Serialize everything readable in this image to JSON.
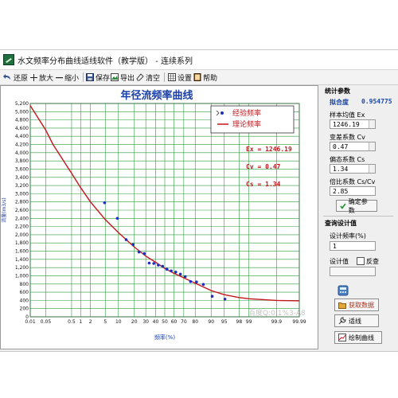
{
  "window": {
    "title": "水文频率分布曲线适线软件（教学版） - 连续系列"
  },
  "toolbar": {
    "restore": "还原",
    "zoom_in": "放大",
    "zoom_out": "缩小",
    "save": "保存",
    "export": "导出",
    "clear": "清空",
    "settings": "设置",
    "help": "帮助"
  },
  "colors": {
    "theory_curve": "#c4161c",
    "points": "#1f2fbf",
    "grid": "#2e9a3e",
    "title": "#1a3fa8",
    "stats_text": "#c4161c"
  },
  "chart": {
    "legend_empirical": "经验频率",
    "legend_theory": "理论频率",
    "stat_ex": "Ex = 1246.19",
    "stat_cv": "Cv = 0.47",
    "stat_cs": "Cs = 1.34"
  },
  "chart_data": {
    "type": "scatter",
    "title": "年径流频率曲线",
    "xlabel": "频率(%)",
    "ylabel": "流量(m3/s)",
    "ylim": [
      0,
      5200
    ],
    "yticks": [
      0,
      200,
      400,
      600,
      800,
      1000,
      1200,
      1400,
      1600,
      1800,
      2000,
      2200,
      2400,
      2600,
      2800,
      3000,
      3200,
      3400,
      3600,
      3800,
      4000,
      4200,
      4400,
      4600,
      4800,
      5000,
      5200
    ],
    "xticks": [
      0.01,
      0.05,
      0.5,
      1,
      2,
      5,
      10,
      20,
      30,
      40,
      50,
      60,
      70,
      80,
      90,
      95,
      98,
      99,
      99.9,
      99.99
    ],
    "x_scale": "probability",
    "grid": true,
    "legend_position": "top-right",
    "series": [
      {
        "name": "经验频率",
        "kind": "scatter",
        "x": [
          4.8,
          9.5,
          14.3,
          19.0,
          23.8,
          28.6,
          33.3,
          38.1,
          42.9,
          47.6,
          52.4,
          57.1,
          61.9,
          66.7,
          71.4,
          76.2,
          81.0,
          85.7,
          90.5,
          95.2
        ],
        "y": [
          2780,
          2400,
          1880,
          1760,
          1580,
          1540,
          1310,
          1300,
          1260,
          1230,
          1160,
          1120,
          1090,
          1040,
          980,
          860,
          850,
          790,
          500,
          430
        ]
      },
      {
        "name": "理论频率",
        "kind": "line",
        "x": [
          0.01,
          0.05,
          0.1,
          0.5,
          1,
          2,
          5,
          10,
          20,
          30,
          40,
          50,
          60,
          70,
          80,
          90,
          95,
          98,
          99,
          99.9,
          99.99
        ],
        "y": [
          5150,
          4550,
          4200,
          3500,
          3150,
          2800,
          2370,
          2050,
          1700,
          1480,
          1330,
          1180,
          1060,
          950,
          820,
          640,
          540,
          470,
          440,
          400,
          390
        ]
      }
    ]
  },
  "panel": {
    "stats_group": "统计参数",
    "fit_label": "拟合度",
    "fit_value": "0.954775",
    "mean_label": "样本均值 Ex",
    "mean_value": "1246.19",
    "cv_label": "变差系数 Cv",
    "cv_value": "0.47",
    "cs_label": "偏态系数 Cs",
    "cs_value": "1.34",
    "ratio_label": "倍比系数 Cs/Cv",
    "ratio_value": "2.85",
    "confirm_button": "确定参数",
    "query_group": "查询设计值",
    "design_freq_label": "设计频率(%)",
    "design_freq_value": "1",
    "design_value_label": "设计值",
    "reverse_label": "反查",
    "get_data_button": "获取数据",
    "fit_button": "适线",
    "draw_button": "绘制曲线"
  },
  "watermark": "百度Q:0.1%3-A8"
}
